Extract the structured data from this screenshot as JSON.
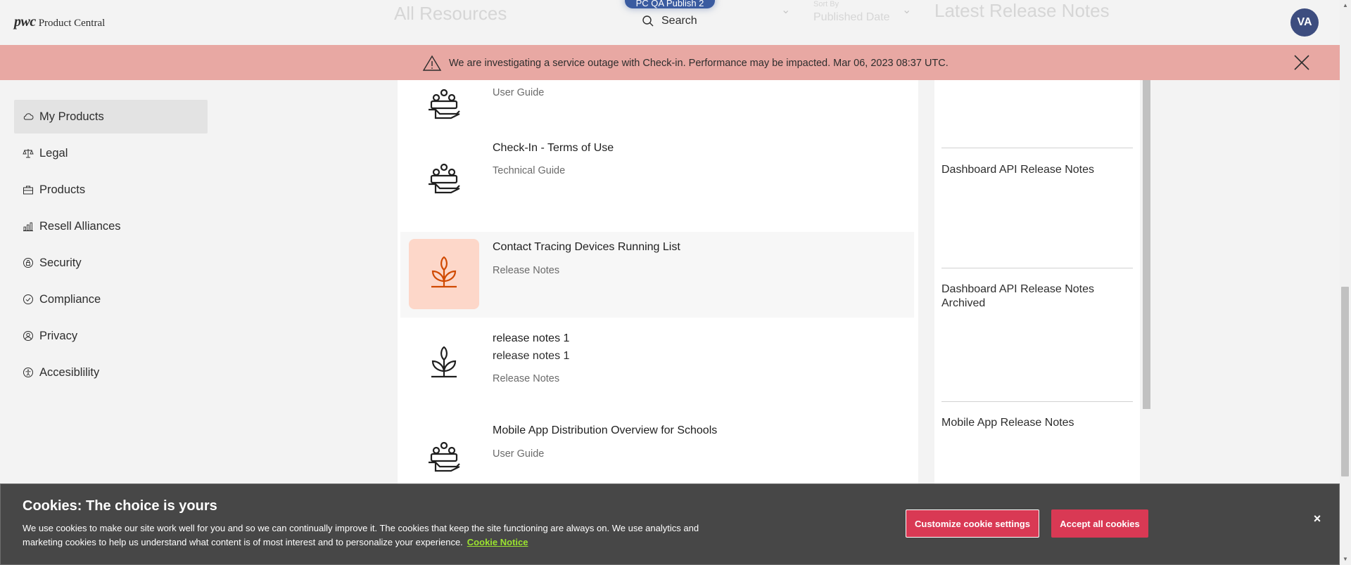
{
  "header": {
    "logo_mark": "pwc",
    "logo_text": "Product Central",
    "ghost_title_resources": "All Resources",
    "ghost_title_release": "Latest Release Notes",
    "ghost_sort_label": "Sort By",
    "ghost_sort_value": "Published Date",
    "ghost_pill": "PC QA Publish 2",
    "search_label": "Search",
    "avatar_initials": "VA"
  },
  "banner": {
    "message": "We are investigating a service outage with Check-in. Performance may be impacted. Mar 06, 2023 08:37 UTC."
  },
  "sidebar": {
    "items": [
      {
        "label": "My Products",
        "icon": "cloud-icon"
      },
      {
        "label": "Legal",
        "icon": "scales-icon"
      },
      {
        "label": "Products",
        "icon": "briefcase-icon"
      },
      {
        "label": "Resell Alliances",
        "icon": "chart-hand-icon"
      },
      {
        "label": "Security",
        "icon": "lock-shield-icon"
      },
      {
        "label": "Compliance",
        "icon": "check-circle-icon"
      },
      {
        "label": "Privacy",
        "icon": "user-circle-icon"
      },
      {
        "label": "Accesiblility",
        "icon": "accessibility-icon"
      }
    ]
  },
  "resources": {
    "items": [
      {
        "title": "",
        "subtitle": "",
        "type": "User Guide",
        "icon": "people-hand-icon"
      },
      {
        "title": "Check-In - Terms of Use",
        "subtitle": "",
        "type": "Technical Guide",
        "icon": "people-hand-icon"
      },
      {
        "title": "Contact Tracing Devices Running List",
        "subtitle": "",
        "type": "Release Notes",
        "icon": "sprout-icon"
      },
      {
        "title": "release notes 1",
        "subtitle": "release notes 1",
        "type": "Release Notes",
        "icon": "sprout-icon"
      },
      {
        "title": "Mobile App Distribution Overview for Schools",
        "subtitle": "",
        "type": "User Guide",
        "icon": "people-hand-icon"
      }
    ]
  },
  "release_notes": {
    "items": [
      {
        "title": "Dashboard API Release Notes"
      },
      {
        "title": "Dashboard API Release Notes Archived"
      },
      {
        "title": "Mobile App Release Notes"
      }
    ]
  },
  "cookie": {
    "title": "Cookies: The choice is yours",
    "text": "We use cookies to make our site work well for you and so we can continually improve it. The cookies that keep the site functioning are always on. We use analytics and marketing cookies to help us understand what content is of most interest and to personalize your experience.",
    "link": "Cookie Notice",
    "customize_label": "Customize cookie settings",
    "accept_label": "Accept all cookies",
    "close_label": "×"
  },
  "colors": {
    "banner_bg": "#e8a8a3",
    "accent_orange": "#d04a02",
    "accent_orange_bg": "#fdd7c9",
    "cookie_bg": "#474747",
    "cookie_button": "#d93954",
    "cookie_link": "#9be32f",
    "avatar_bg": "#3d4d7f"
  }
}
